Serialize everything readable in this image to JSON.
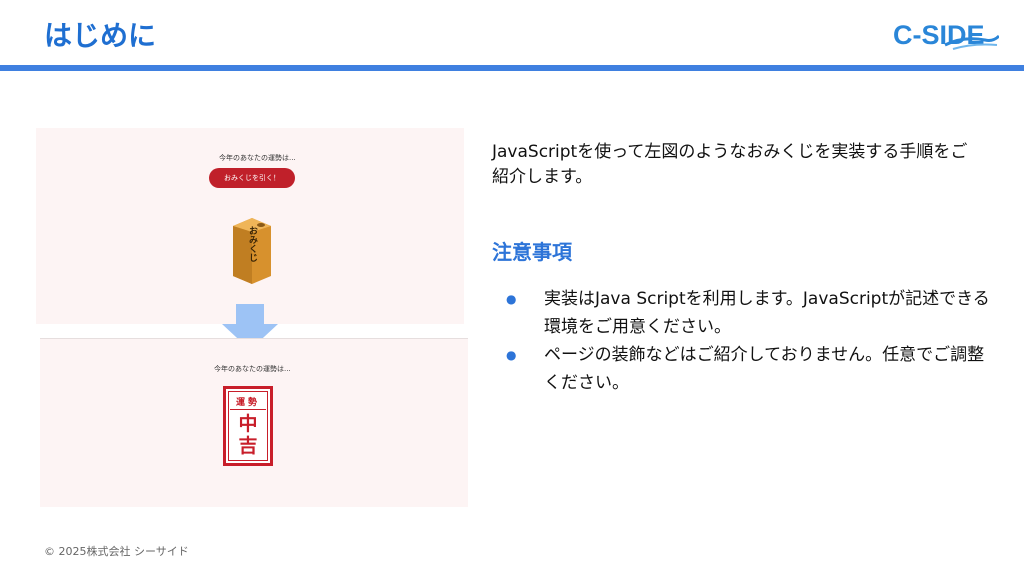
{
  "header": {
    "title": "はじめに",
    "logo_text": "C-SIDE"
  },
  "demo": {
    "prompt_text": "今年のあなたの運勢は...",
    "button_label": "おみくじを引く！",
    "box_label": "おみくじ",
    "result_prompt": "今年のあなたの運勢は...",
    "fortune_title": "運勢",
    "fortune_result": "中吉"
  },
  "content": {
    "description": "JavaScriptを使って左図のようなおみくじを実装する手順をご紹介します。",
    "caution_heading": "注意事項",
    "bullets": [
      "実装はJava Scriptを利用します。JavaScriptが記述できる環境をご用意ください。",
      "ページの装飾などはご紹介しておりません。任意でご調整ください。"
    ]
  },
  "footer": {
    "copyright": "© 2025株式会社 シーサイド"
  },
  "colors": {
    "accent": "#3f80e0",
    "title": "#1f6fd1",
    "button": "#c0202a",
    "stamp": "#c81e2a",
    "arrow": "#9dc3f5"
  }
}
